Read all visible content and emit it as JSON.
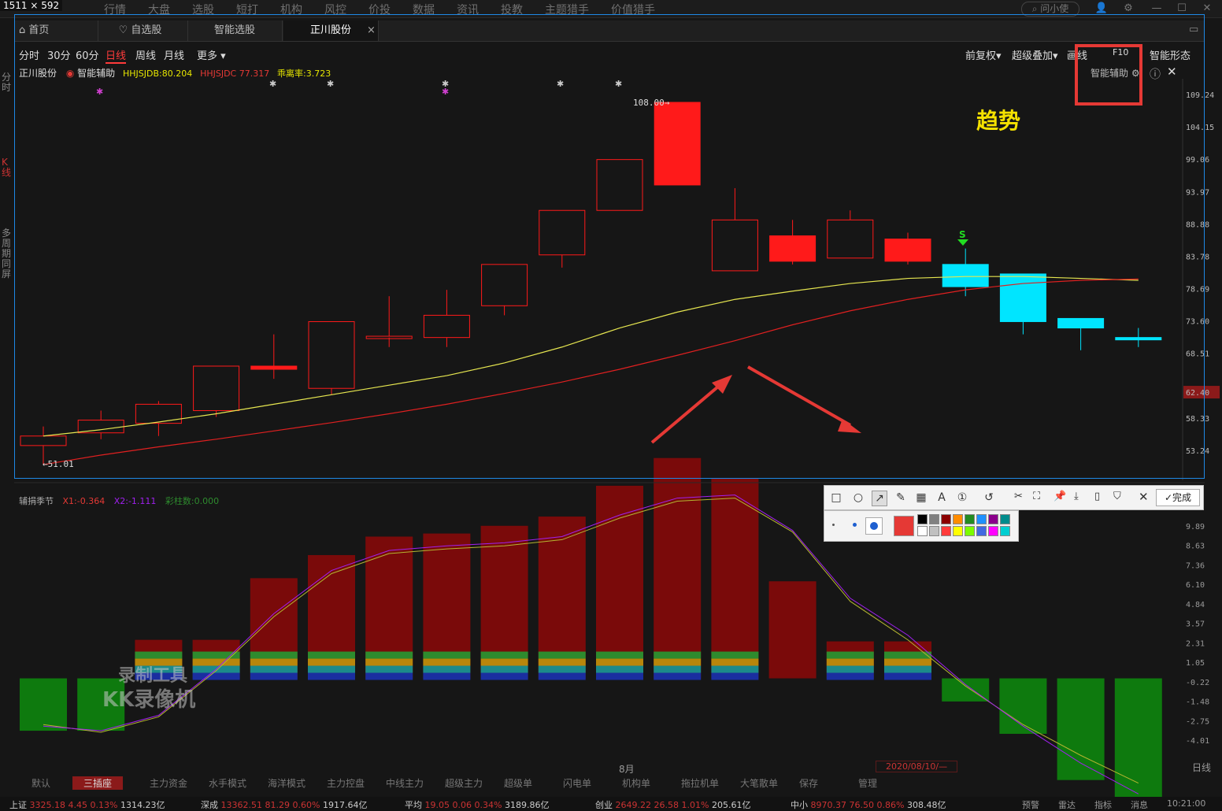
{
  "capture_size": "1511 × 592",
  "top_menu": [
    "行情",
    "大盘",
    "选股",
    "短打",
    "机构",
    "风控",
    "价投",
    "数据",
    "资讯",
    "投教",
    "主题猎手",
    "价值猎手"
  ],
  "search_placeholder": "问小使",
  "tabs": [
    {
      "label": "首页",
      "icon": "home-icon"
    },
    {
      "label": "自选股",
      "icon": "heart-icon"
    },
    {
      "label": "智能选股"
    },
    {
      "label": "正川股份"
    }
  ],
  "periods": [
    "分时",
    "30分",
    "60分",
    "日线",
    "周线",
    "月线",
    "更多"
  ],
  "active_period": "日线",
  "right_tools": [
    "前复权",
    "超级叠加",
    "画线",
    "F10",
    "智能形态"
  ],
  "legend": {
    "stock": "正川股份",
    "assist": "智能辅助",
    "i1": "HHJSJDB:80.204",
    "i2": "HHJSJDC 77.317",
    "i3": "乖离率:3.723"
  },
  "assist_label": "智能辅助",
  "left_vertical": {
    "a": "分时",
    "b": "K线",
    "c": "多周期同屏"
  },
  "annotation": "趋势",
  "high_label": "108.00",
  "low_label": "51.01",
  "signal_label": "S",
  "price_axis": [
    "109.24",
    "104.15",
    "99.06",
    "93.97",
    "88.88",
    "83.78",
    "78.69",
    "73.60",
    "68.51",
    "62.40",
    "58.33",
    "53.24"
  ],
  "current_price": "62.40",
  "lower_legend": {
    "name": "辅捐季节",
    "x1": "X1:-0.364",
    "x2": "X2:-1.111",
    "x3": "彩柱数:0.000"
  },
  "lower_axis": [
    "9.89",
    "8.63",
    "7.36",
    "6.10",
    "4.84",
    "3.57",
    "2.31",
    "1.05",
    "-0.22",
    "-1.48",
    "-2.75",
    "-4.01"
  ],
  "watermark": {
    "line1": "录制工具",
    "line2": "KK录像机"
  },
  "draw_done": "完成",
  "palette": [
    "#000000",
    "#808080",
    "#8b0000",
    "#ff8c00",
    "#228b22",
    "#1e90ff",
    "#8b008b",
    "#008b8b",
    "#ffffff",
    "#c0c0c0",
    "#ff3b3b",
    "#ffff00",
    "#7cfc00",
    "#4169e1",
    "#ff00ff",
    "#00ced1"
  ],
  "selected_color": "#e53935",
  "bottom_tabs": [
    "默认",
    "三插座",
    "主力资金",
    "水手模式",
    "海洋模式",
    "主力控盘",
    "中线主力",
    "超级主力",
    "超级单",
    "闪电单",
    "机构单",
    "拖拉机单",
    "大笔散单",
    "保存",
    "管理"
  ],
  "active_bottom": "三插座",
  "date_label": "8月",
  "date_range": "2020/08/10/—",
  "period_right": "日线",
  "status": [
    {
      "name": "上证",
      "val": "3325.18",
      "chg": "4.45",
      "pct": "0.13%",
      "amt": "1314.23亿"
    },
    {
      "name": "深成",
      "val": "13362.51",
      "chg": "81.29",
      "pct": "0.60%",
      "amt": "1917.64亿"
    },
    {
      "name": "平均",
      "val": "19.05",
      "chg": "0.06",
      "pct": "0.34%",
      "amt": "3189.86亿"
    },
    {
      "name": "创业",
      "val": "2649.22",
      "chg": "26.58",
      "pct": "1.01%",
      "amt": "205.61亿"
    },
    {
      "name": "中小",
      "val": "8970.37",
      "chg": "76.50",
      "pct": "0.86%",
      "amt": "308.48亿"
    }
  ],
  "status_right": [
    "预警",
    "雷达",
    "指标",
    "消息",
    "10:21:00"
  ],
  "chart_data": {
    "type": "candlestick",
    "price_range": [
      51.01,
      108.0
    ],
    "candles": [
      {
        "o": 54.0,
        "c": 55.5,
        "h": 57.0,
        "l": 51.0,
        "t": "up"
      },
      {
        "o": 56.0,
        "c": 58.0,
        "h": 59.5,
        "l": 55.0,
        "t": "up"
      },
      {
        "o": 57.5,
        "c": 60.5,
        "h": 61.0,
        "l": 55.5,
        "t": "up"
      },
      {
        "o": 59.5,
        "c": 66.5,
        "h": 66.5,
        "l": 58.5,
        "t": "up"
      },
      {
        "o": 66.0,
        "c": 66.5,
        "h": 71.5,
        "l": 64.5,
        "t": "upfill"
      },
      {
        "o": 63.0,
        "c": 73.5,
        "h": 73.5,
        "l": 62.0,
        "t": "up"
      },
      {
        "o": 71.0,
        "c": 71.2,
        "h": 77.5,
        "l": 69.5,
        "t": "up"
      },
      {
        "o": 71.0,
        "c": 74.5,
        "h": 78.5,
        "l": 69.5,
        "t": "up"
      },
      {
        "o": 76.0,
        "c": 82.5,
        "h": 82.5,
        "l": 74.5,
        "t": "up"
      },
      {
        "o": 84.0,
        "c": 91.0,
        "h": 91.0,
        "l": 82.0,
        "t": "up"
      },
      {
        "o": 91.0,
        "c": 99.0,
        "h": 99.0,
        "l": 91.0,
        "t": "up"
      },
      {
        "o": 108.0,
        "c": 95.0,
        "h": 108.0,
        "l": 95.0,
        "t": "down"
      },
      {
        "o": 81.5,
        "c": 89.5,
        "h": 94.5,
        "l": 81.5,
        "t": "up"
      },
      {
        "o": 87.0,
        "c": 83.0,
        "h": 89.5,
        "l": 82.5,
        "t": "down"
      },
      {
        "o": 83.5,
        "c": 89.5,
        "h": 91.0,
        "l": 83.5,
        "t": "up"
      },
      {
        "o": 86.5,
        "c": 83.0,
        "h": 87.5,
        "l": 82.5,
        "t": "down"
      },
      {
        "o": 82.5,
        "c": 79.0,
        "h": 85.0,
        "l": 77.5,
        "t": "cyan"
      },
      {
        "o": 81.0,
        "c": 73.5,
        "h": 81.0,
        "l": 71.5,
        "t": "cyan"
      },
      {
        "o": 74.0,
        "c": 72.5,
        "h": 74.0,
        "l": 69.0,
        "t": "cyan"
      },
      {
        "o": 71.0,
        "c": 70.8,
        "h": 72.5,
        "l": 69.5,
        "t": "cyan"
      }
    ],
    "ma_yellow": [
      55.5,
      56.5,
      57.7,
      59.0,
      60.5,
      62.0,
      63.5,
      65.0,
      67.0,
      69.5,
      72.5,
      75.0,
      77.0,
      78.3,
      79.5,
      80.3,
      80.6,
      80.6,
      80.3,
      80.0
    ],
    "ma_red": [
      51.0,
      52.5,
      53.8,
      55.0,
      56.3,
      57.6,
      59.0,
      60.5,
      62.2,
      64.0,
      66.0,
      68.2,
      70.5,
      73.0,
      75.2,
      77.0,
      78.5,
      79.5,
      80.0,
      80.2
    ],
    "lower": {
      "bars": [
        -3.4,
        -3.4,
        2.5,
        2.5,
        6.5,
        8.0,
        9.2,
        9.4,
        9.9,
        10.5,
        12.5,
        14.3,
        13.0,
        6.3,
        2.4,
        2.4,
        -1.5,
        -3.6,
        -6.6,
        -8.4,
        -8.3
      ],
      "line1": [
        -3.0,
        -3.5,
        -2.5,
        0.5,
        4.0,
        6.8,
        8.1,
        8.4,
        8.6,
        9.0,
        10.4,
        11.5,
        11.7,
        9.5,
        5.0,
        2.5,
        -0.5,
        -3.0,
        -5.0,
        -6.8,
        -7.8
      ],
      "line2": [
        -3.1,
        -3.4,
        -2.4,
        0.6,
        4.2,
        7.0,
        8.3,
        8.6,
        8.8,
        9.2,
        10.6,
        11.7,
        11.9,
        9.6,
        5.2,
        2.8,
        -0.4,
        -3.1,
        -5.5,
        -7.5,
        -8.3
      ]
    }
  }
}
